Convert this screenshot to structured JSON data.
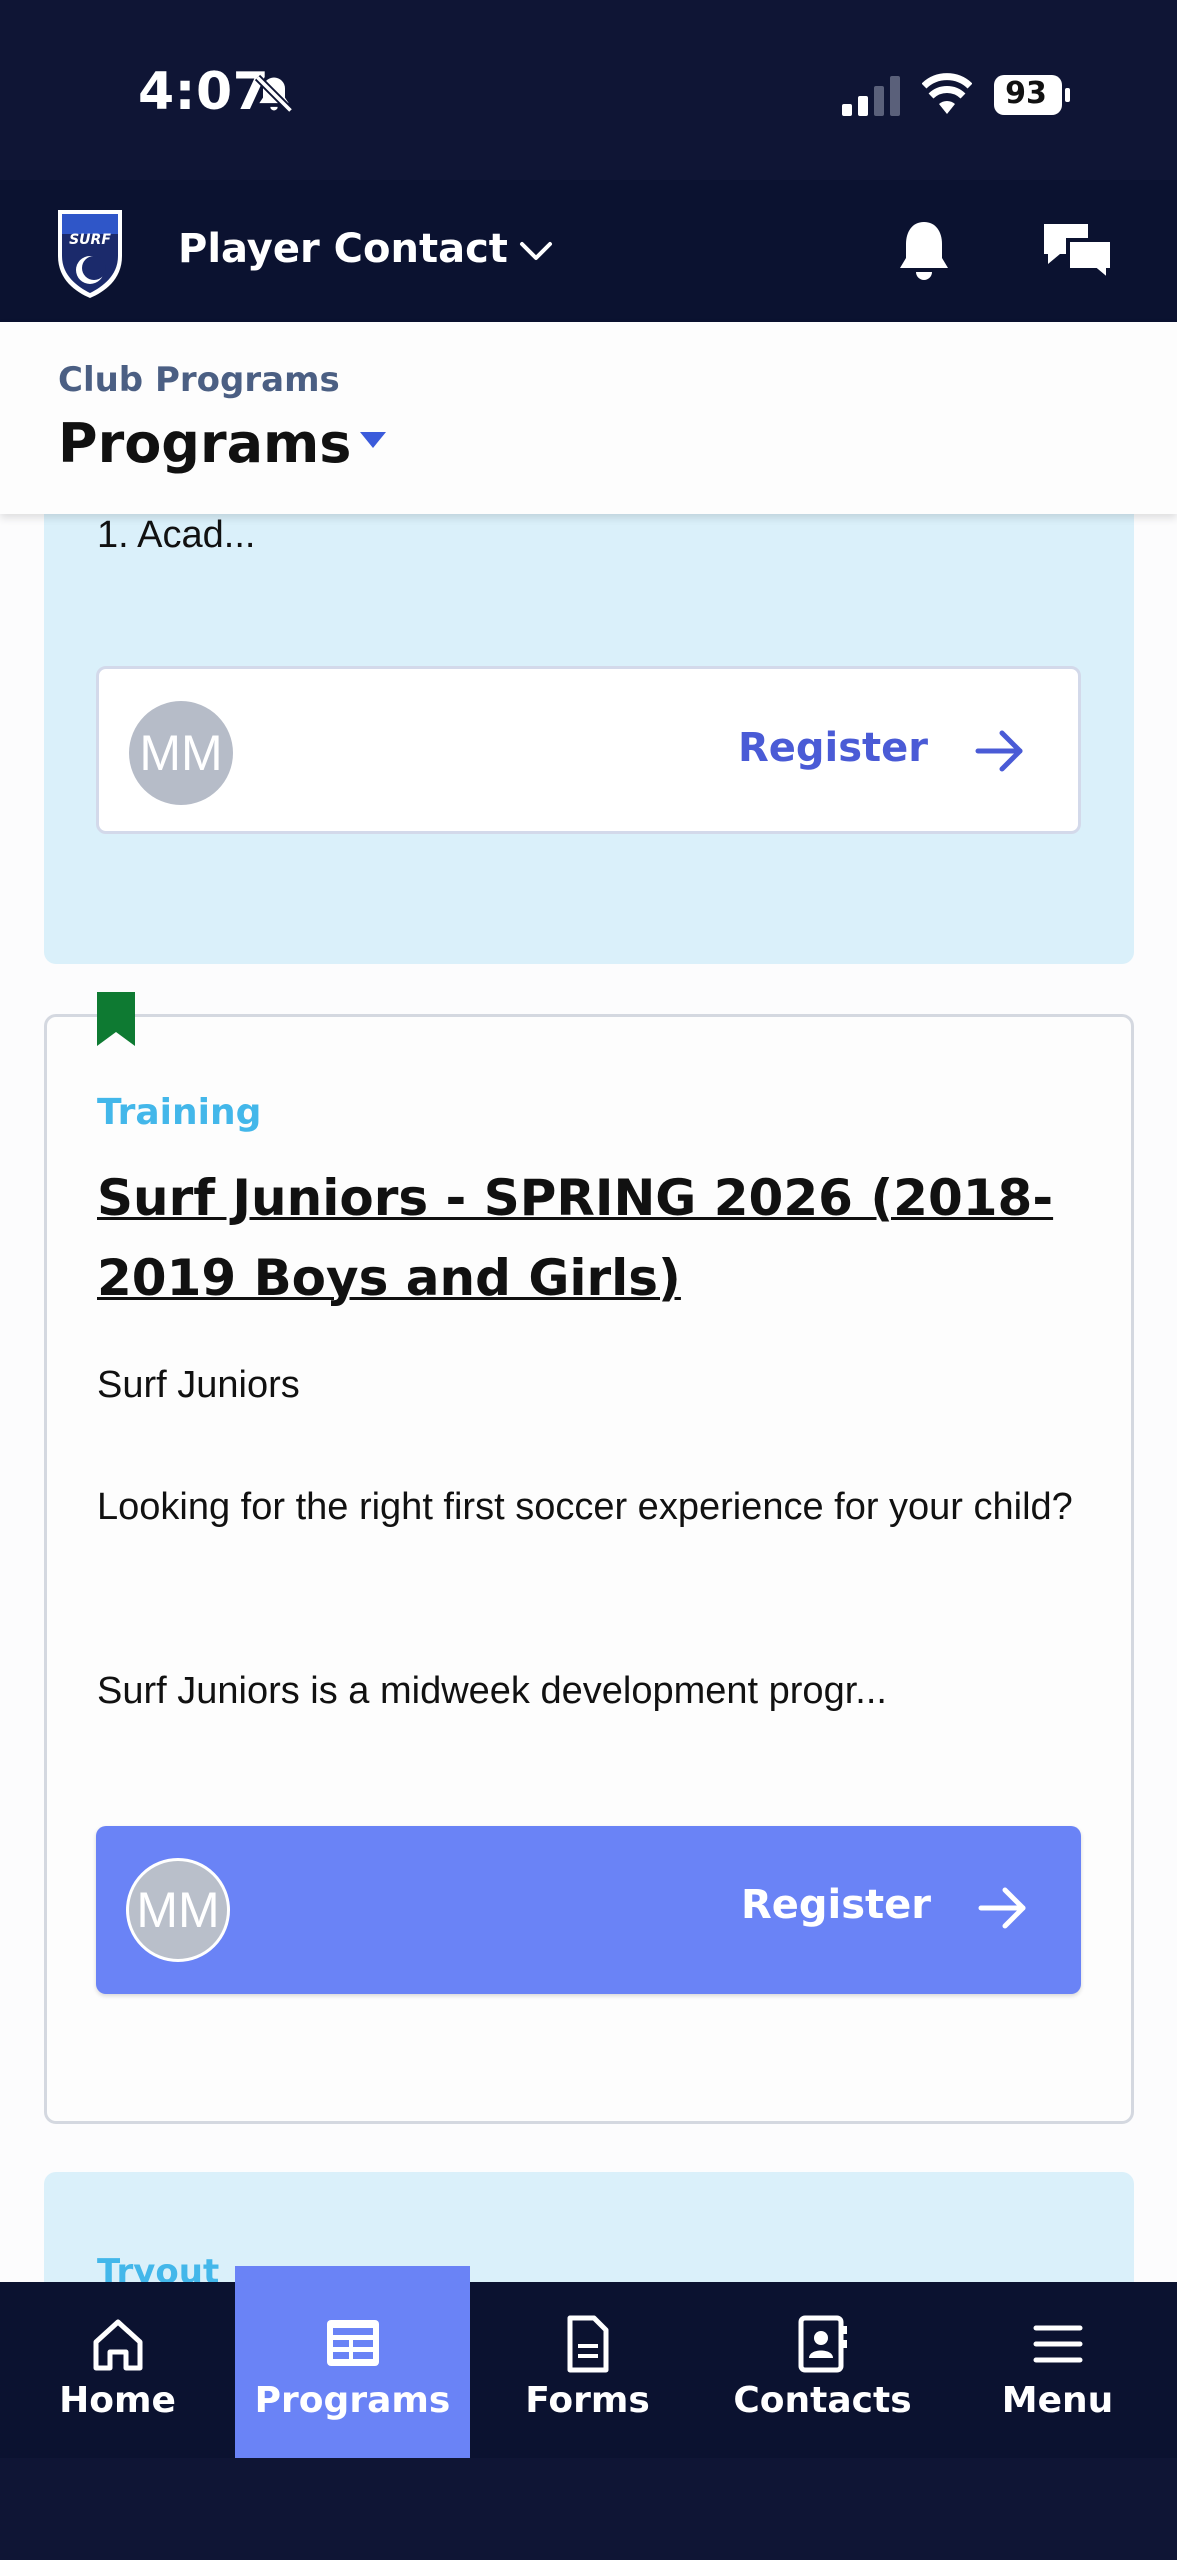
{
  "status_bar": {
    "time": "4:07",
    "battery": "93",
    "icons": [
      "bell-slash-icon",
      "signal-icon",
      "wifi-icon",
      "battery-icon"
    ]
  },
  "header": {
    "context_title": "Player Contact",
    "icons": [
      "club-logo",
      "chevron-down-icon",
      "bell-icon",
      "chat-icon"
    ]
  },
  "sub_header": {
    "breadcrumb": "Club Programs",
    "title": "Programs"
  },
  "cards": [
    {
      "visible_text": "1. Acad...",
      "register": {
        "avatar": "MM",
        "label": "Register"
      },
      "background": "#daf0fa"
    },
    {
      "category": "Training",
      "title": "Surf Juniors - SPRING 2026 (2018-2019 Boys and Girls)",
      "description": [
        "Surf Juniors",
        "Looking for the right first soccer experience for your child?",
        "Surf Juniors is a midweek development progr..."
      ],
      "register": {
        "avatar": "MM",
        "label": "Register"
      },
      "bookmark_color": "#0e7a32"
    },
    {
      "category": "Tryout",
      "background": "#daf0fa"
    }
  ],
  "bottom_nav": {
    "active": "Programs",
    "items": [
      {
        "label": "Home",
        "icon": "home-icon"
      },
      {
        "label": "Programs",
        "icon": "programs-icon"
      },
      {
        "label": "Forms",
        "icon": "forms-icon"
      },
      {
        "label": "Contacts",
        "icon": "contacts-icon"
      },
      {
        "label": "Menu",
        "icon": "menu-icon"
      }
    ]
  },
  "colors": {
    "header_bg": "#0b1230",
    "accent": "#6a83f6",
    "link": "#4a5bd6",
    "category": "#43b7ea"
  }
}
